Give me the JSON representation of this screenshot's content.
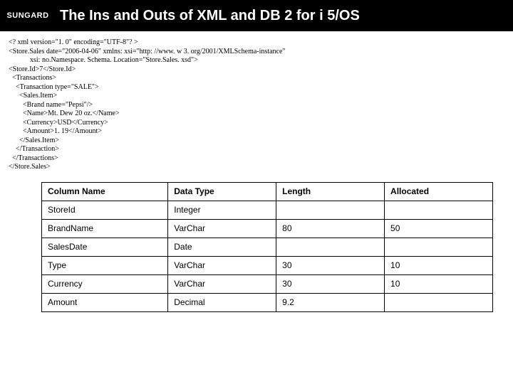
{
  "header": {
    "logo": "SUNGARD",
    "title": "The Ins and Outs of XML and DB 2 for i 5/OS"
  },
  "xml_lines": [
    "<? xml version=\"1. 0\" encoding=\"UTF-8\"? >",
    "<Store.Sales date=\"2006-04-06\" xmlns: xsi=\"http: //www. w 3. org/2001/XMLSchema-instance\"",
    "            xsi: no.Namespace. Schema. Location=\"Store.Sales. xsd\">",
    "<Store.Id>7</Store.Id>",
    "  <Transactions>",
    "    <Transaction type=\"SALE\">",
    "      <Sales.Item>",
    "        <Brand name=\"Pepsi\"/>",
    "        <Name>Mt. Dew 20 oz.</Name>",
    "        <Currency>USD</Currency>",
    "        <Amount>1. 19</Amount>",
    "      </Sales.Item>",
    "    </Transaction>",
    "  </Transactions>",
    "</Store.Sales>"
  ],
  "table": {
    "headers": [
      "Column Name",
      "Data Type",
      "Length",
      "Allocated"
    ],
    "rows": [
      [
        "StoreId",
        "Integer",
        "",
        ""
      ],
      [
        "BrandName",
        "VarChar",
        "80",
        "50"
      ],
      [
        "SalesDate",
        "Date",
        "",
        ""
      ],
      [
        "Type",
        "VarChar",
        "30",
        "10"
      ],
      [
        "Currency",
        "VarChar",
        "30",
        "10"
      ],
      [
        "Amount",
        "Decimal",
        "9.2",
        ""
      ]
    ]
  }
}
